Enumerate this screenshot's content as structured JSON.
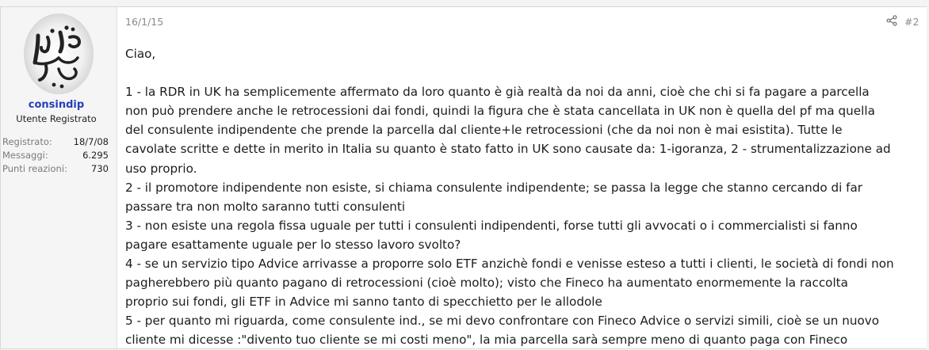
{
  "user": {
    "name": "consindip",
    "title": "Utente Registrato",
    "stats": [
      {
        "label": "Registrato:",
        "value": "18/7/08"
      },
      {
        "label": "Messaggi:",
        "value": "6.295"
      },
      {
        "label": "Punti reazioni:",
        "value": "730"
      }
    ]
  },
  "post": {
    "date": "16/1/15",
    "number": "#2",
    "lines": [
      "Ciao,",
      "",
      "1 - la RDR in UK ha semplicemente affermato da loro quanto è già realtà da noi da anni, cioè che chi si fa pagare a parcella",
      "non può prendere anche le retrocessioni dai fondi, quindi la figura che è stata cancellata in UK non è quella del pf ma quella",
      "del consulente indipendente che prende la parcella dal cliente+le retrocessioni (che da noi non è mai esistita). Tutte le",
      "cavolate scritte e dette in merito in Italia su quanto è stato fatto in UK sono causate da: 1-igoranza, 2 - strumentalizzazione ad",
      "uso proprio.",
      "2 - il promotore indipendente non esiste, si chiama consulente indipendente; se passa la legge che stanno cercando di far",
      "passare tra non molto saranno tutti consulenti",
      "3 - non esiste una regola fissa uguale per tutti i consulenti indipendenti, forse tutti gli avvocati o i commercialisti si fanno",
      "pagare esattamente uguale per lo stesso lavoro svolto?",
      "4 - se un servizio tipo Advice arrivasse a proporre solo ETF anzichè fondi e venisse esteso a tutti i clienti, le società di fondi non",
      "pagherebbero più quanto pagano di retrocessioni (cioè molto); visto che Fineco ha aumentato enormemente la raccolta",
      "proprio sui fondi, gli ETF in Advice mi sanno tanto di specchietto per le allodole",
      "5 - per quanto mi riguarda, come consulente ind., se mi devo confrontare con Fineco Advice o servizi simili, cioè se un nuovo",
      "cliente mi dicesse :\"divento tuo cliente se mi costi meno\", la mia parcella sarà sempre meno di quanto paga con Fineco"
    ]
  },
  "icons": {
    "share": "share-icon",
    "avatar": "avatar-calligraphy"
  },
  "colors": {
    "username": "#2540b8",
    "meta": "#8a8a8a",
    "sidebar": "#f5f5f5"
  }
}
